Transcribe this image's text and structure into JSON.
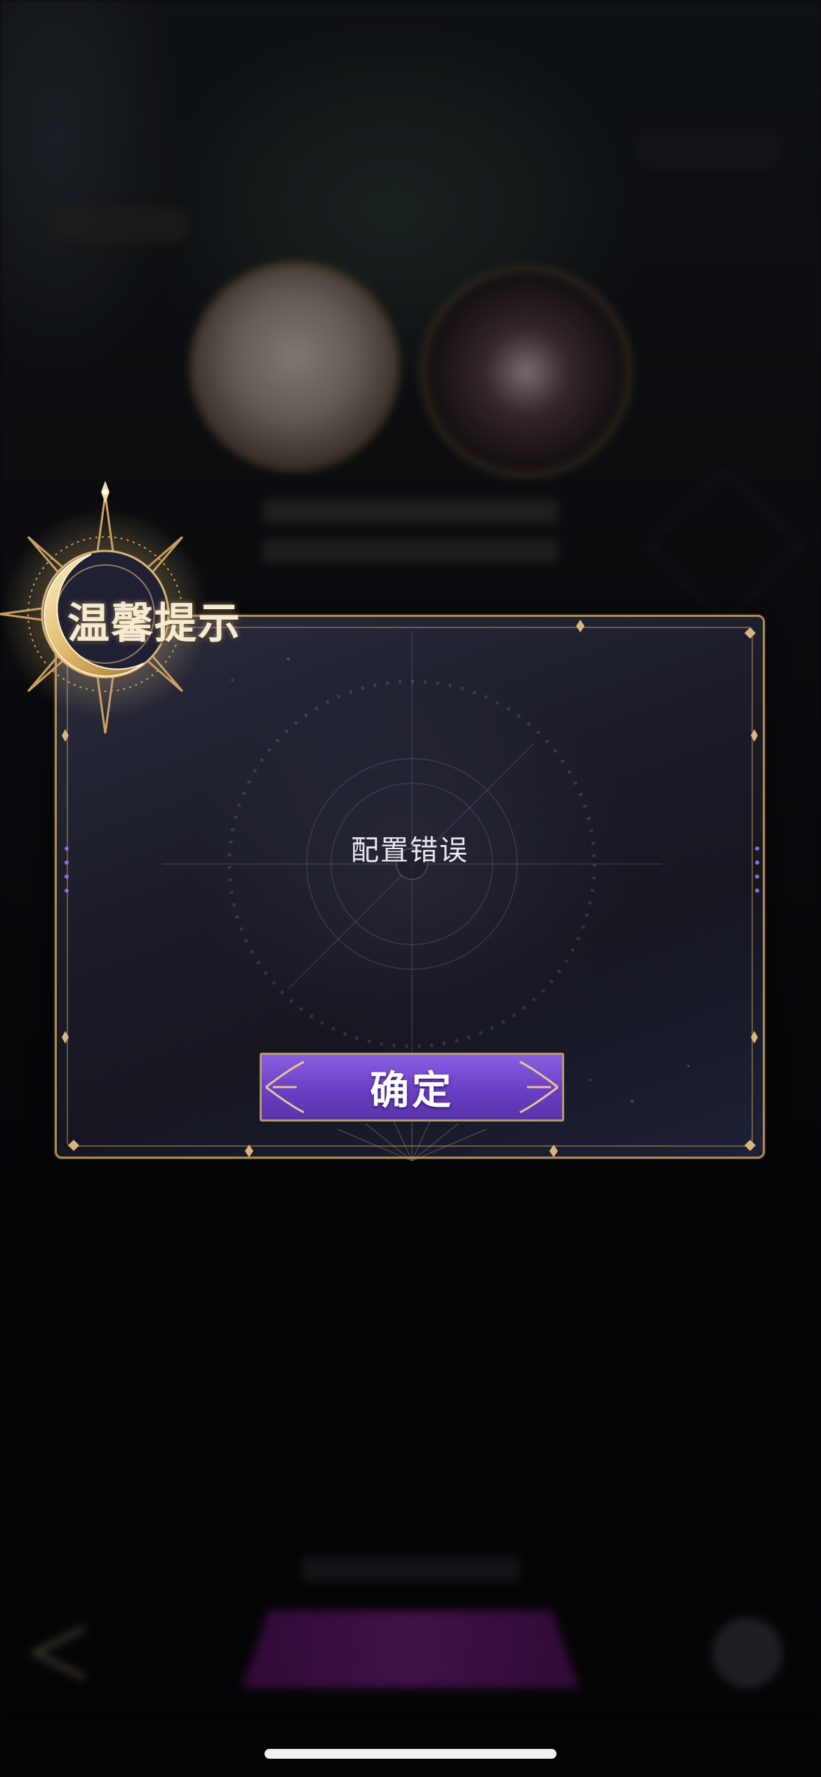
{
  "dialog": {
    "title": "温馨提示",
    "message": "配置错误",
    "confirm_label": "确定"
  },
  "colors": {
    "accent_gold": "#b08c55",
    "button_purple": "#6a3fc5",
    "panel_dark": "#1b1c28"
  }
}
